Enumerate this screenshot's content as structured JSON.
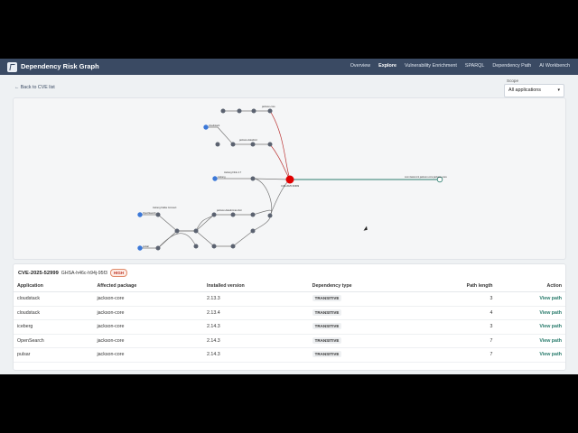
{
  "app_title": "Dependency Risk Graph",
  "nav": [
    {
      "label": "Overview"
    },
    {
      "label": "Explore",
      "active": true
    },
    {
      "label": "Vulnerability Enrichment"
    },
    {
      "label": "SPARQL"
    },
    {
      "label": "Dependency Path"
    },
    {
      "label": "AI Workbench"
    }
  ],
  "back_link": "← Back to CVE list",
  "scope": {
    "label": "Scope",
    "value": "All applications"
  },
  "graph": {
    "cve_node_label": "CVE-2025-52999",
    "target_node_label": "com.fasterxml.jackson.core:jackson-core",
    "node_labels": [
      "cloudstack",
      "iceberg",
      "OpenSearch",
      "pulsar",
      "jackson-core",
      "jackson-databind",
      "jackson-dataformat-cbor",
      "Iceberg Flink 4.7",
      "Iceberg Kafka Connect"
    ]
  },
  "table": {
    "cve_id": "CVE-2025-52999",
    "ghsa_id": "GHSA-h46c-h94j-95f3",
    "severity": "HIGH",
    "columns": [
      "Application",
      "Affected package",
      "Installed version",
      "Dependency type",
      "Path length",
      "Action"
    ],
    "rows": [
      {
        "application": "cloudstack",
        "package": "jackson-core",
        "version": "2.13.3",
        "type": "TRANSITIVE",
        "path_length": "3",
        "action": "View path"
      },
      {
        "application": "cloudstack",
        "package": "jackson-core",
        "version": "2.13.4",
        "type": "TRANSITIVE",
        "path_length": "4",
        "action": "View path"
      },
      {
        "application": "iceberg",
        "package": "jackson-core",
        "version": "2.14.3",
        "type": "TRANSITIVE",
        "path_length": "3",
        "action": "View path"
      },
      {
        "application": "OpenSearch",
        "package": "jackson-core",
        "version": "2.14.3",
        "type": "TRANSITIVE",
        "path_length": "7",
        "action": "View path"
      },
      {
        "application": "pulsar",
        "package": "jackson-core",
        "version": "2.14.3",
        "type": "TRANSITIVE",
        "path_length": "7",
        "action": "View path"
      }
    ]
  },
  "colors": {
    "accent": "#2a7c6d",
    "cve_node": "#e00000",
    "app_node": "#3b78d8",
    "dep_node": "#5b6270",
    "topbar": "#3a4a63",
    "severity": "#c0392b"
  }
}
